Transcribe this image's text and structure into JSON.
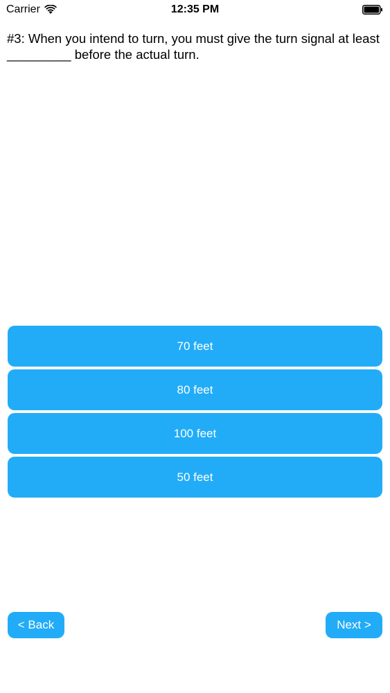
{
  "status_bar": {
    "carrier": "Carrier",
    "time": "12:35 PM",
    "wifi_icon": "wifi-icon",
    "battery_icon": "battery-icon"
  },
  "question": {
    "text": "#3: When you intend to turn, you must give the turn signal at least _________ before the actual turn."
  },
  "answers": [
    {
      "label": "70 feet"
    },
    {
      "label": "80 feet"
    },
    {
      "label": "100 feet"
    },
    {
      "label": "50 feet"
    }
  ],
  "nav": {
    "back_label": "< Back",
    "next_label": "Next >"
  },
  "colors": {
    "button_blue": "#22acf8",
    "button_text": "#ffffff"
  }
}
